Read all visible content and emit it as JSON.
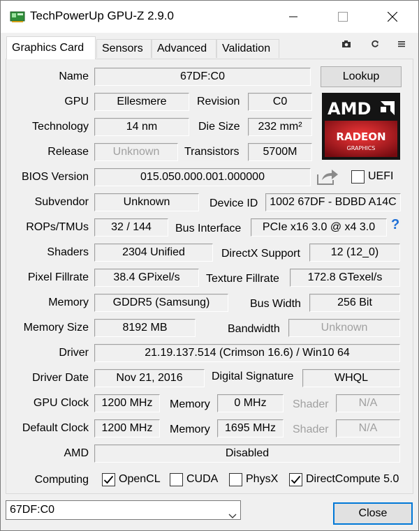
{
  "window": {
    "title": "TechPowerUp GPU-Z 2.9.0"
  },
  "tabs": [
    {
      "label": "Graphics Card"
    },
    {
      "label": "Sensors"
    },
    {
      "label": "Advanced"
    },
    {
      "label": "Validation"
    }
  ],
  "card": {
    "name_label": "Name",
    "name_value": "67DF:C0",
    "lookup_button": "Lookup",
    "gpu_label": "GPU",
    "gpu_value": "Ellesmere",
    "revision_label": "Revision",
    "revision_value": "C0",
    "technology_label": "Technology",
    "technology_value": "14 nm",
    "die_size_label": "Die Size",
    "die_size_value": "232 mm²",
    "release_label": "Release",
    "release_value": "Unknown",
    "transistors_label": "Transistors",
    "transistors_value": "5700M",
    "bios_label": "BIOS Version",
    "bios_value": "015.050.000.001.000000",
    "uefi_label": "UEFI",
    "subvendor_label": "Subvendor",
    "subvendor_value": "Unknown",
    "device_id_label": "Device ID",
    "device_id_value": "1002 67DF - BDBD A14C",
    "rops_label": "ROPs/TMUs",
    "rops_value": "32 / 144",
    "bus_interface_label": "Bus Interface",
    "bus_interface_value": "PCIe x16 3.0 @ x4 3.0",
    "bus_help": "?",
    "shaders_label": "Shaders",
    "shaders_value": "2304 Unified",
    "directx_label": "DirectX Support",
    "directx_value": "12 (12_0)",
    "pixel_fillrate_label": "Pixel Fillrate",
    "pixel_fillrate_value": "38.4 GPixel/s",
    "texture_fillrate_label": "Texture Fillrate",
    "texture_fillrate_value": "172.8 GTexel/s",
    "memory_type_label": "Memory",
    "memory_type_value": "GDDR5 (Samsung)",
    "bus_width_label": "Bus Width",
    "bus_width_value": "256 Bit",
    "memory_size_label": "Memory Size",
    "memory_size_value": "8192 MB",
    "bandwidth_label": "Bandwidth",
    "bandwidth_value": "Unknown",
    "driver_label": "Driver",
    "driver_value": "21.19.137.514 (Crimson 16.6) / Win10 64",
    "driver_date_label": "Driver Date",
    "driver_date_value": "Nov 21, 2016",
    "digital_signature_label": "Digital Signature",
    "digital_signature_value": "WHQL",
    "gpu_clock_label": "GPU Clock",
    "gpu_clock_value": "1200 MHz",
    "gpu_memory_label": "Memory",
    "gpu_memory_value": "0 MHz",
    "gpu_shader_label": "Shader",
    "gpu_shader_value": "N/A",
    "default_clock_label": "Default Clock",
    "default_clock_value": "1200 MHz",
    "default_memory_label": "Memory",
    "default_memory_value": "1695 MHz",
    "default_shader_label": "Shader",
    "default_shader_value": "N/A",
    "amd_label": "AMD",
    "amd_value": "Disabled",
    "computing_label": "Computing",
    "computing": [
      {
        "label": "OpenCL",
        "checked": true
      },
      {
        "label": "CUDA",
        "checked": false
      },
      {
        "label": "PhysX",
        "checked": false
      },
      {
        "label": "DirectCompute 5.0",
        "checked": true
      }
    ]
  },
  "logo": {
    "brand": "AMD",
    "line1": "RADEON",
    "line2": "GRAPHICS",
    "accent": "#e0131b"
  },
  "footer": {
    "selected_gpu": "67DF:C0",
    "close_button": "Close"
  },
  "icons": {
    "app": "gpu-card-icon",
    "minimize": "minimize-icon",
    "maximize": "maximize-icon",
    "close": "close-icon",
    "camera": "camera-icon",
    "refresh": "refresh-icon",
    "menu": "hamburger-menu-icon",
    "share": "share-icon"
  },
  "colors": {
    "focus_blue": "#0078d7",
    "help_blue": "#1e6fd6",
    "disabled_gray": "#a0a0a0"
  }
}
